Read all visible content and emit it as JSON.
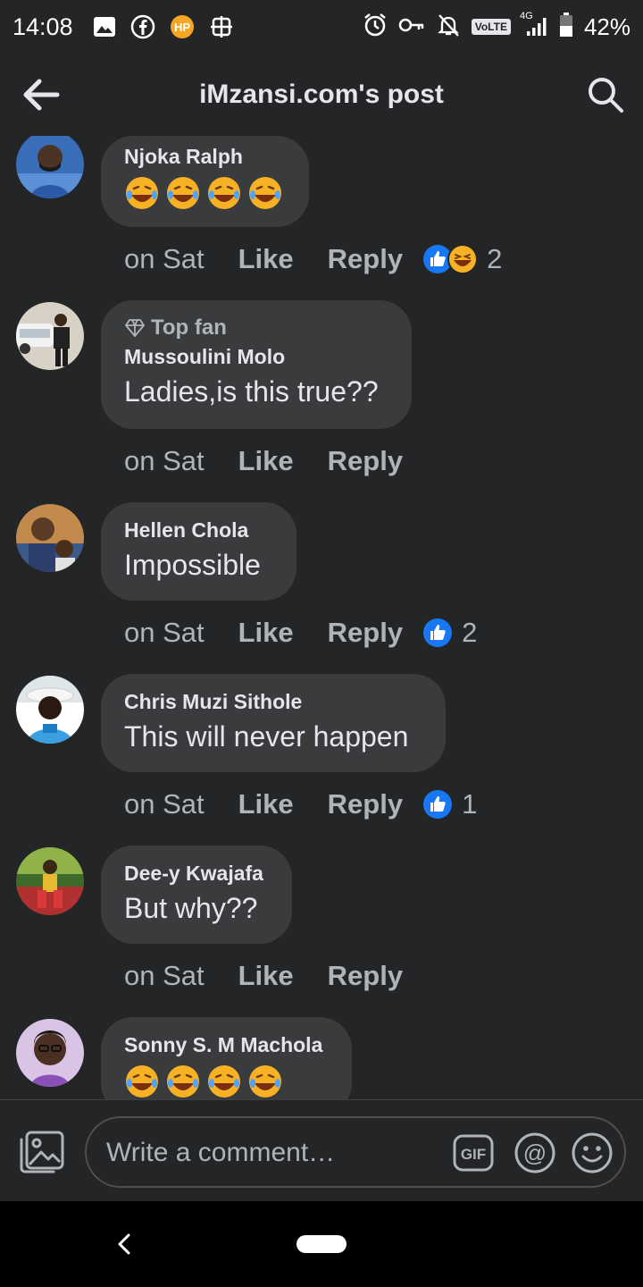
{
  "status_bar": {
    "time": "14:08",
    "volte": "VoLTE",
    "network": "4G",
    "battery": "42%",
    "icons": [
      "image-icon",
      "facebook-icon",
      "app-icon",
      "vpn-icon",
      "alarm-icon",
      "key-icon",
      "mute-icon",
      "signal-icon",
      "battery-icon"
    ]
  },
  "header": {
    "title": "iMzansi.com's post"
  },
  "comments": [
    {
      "author": "Njoka Ralph",
      "emoji_text": "😂😂😂😂",
      "time": "on Sat",
      "like": "Like",
      "reply": "Reply",
      "reactions": [
        "like",
        "haha"
      ],
      "reaction_count": "2"
    },
    {
      "top_fan": "Top fan",
      "author": "Mussoulini Molo",
      "text": "Ladies,is this true??",
      "time": "on Sat",
      "like": "Like",
      "reply": "Reply"
    },
    {
      "author": "Hellen Chola",
      "text": "Impossible",
      "time": "on Sat",
      "like": "Like",
      "reply": "Reply",
      "reactions": [
        "like"
      ],
      "reaction_count": "2"
    },
    {
      "author": "Chris Muzi Sithole",
      "text": "This will never happen",
      "time": "on Sat",
      "like": "Like",
      "reply": "Reply",
      "reactions": [
        "like"
      ],
      "reaction_count": "1"
    },
    {
      "author": "Dee-y Kwajafa",
      "text": "But why??",
      "time": "on Sat",
      "like": "Like",
      "reply": "Reply"
    },
    {
      "author": "Sonny S. M Machola",
      "emoji_text": "😂😂😂😂"
    }
  ],
  "composer": {
    "placeholder": "Write a comment…",
    "gif_label": "GIF"
  },
  "colors": {
    "background": "#242526",
    "bubble": "#3a3b3c",
    "text_primary": "#e4e6eb",
    "text_secondary": "#b0b3b8",
    "like_blue": "#1877f2",
    "haha_yellow": "#f7b125"
  }
}
